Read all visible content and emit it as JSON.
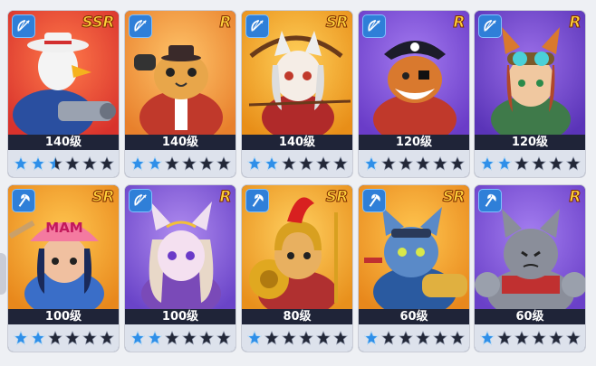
{
  "heroes": [
    {
      "rarity": "SSR",
      "level": "140级",
      "class_icon": "bow-icon",
      "stars_filled": 2.5,
      "art": "eagle-gunner",
      "colors": {
        "bg": "#d8322c",
        "bg2": "#ff7a4a"
      }
    },
    {
      "rarity": "R",
      "level": "140级",
      "class_icon": "bow-icon",
      "stars_filled": 2,
      "art": "fat-cat-banker",
      "colors": {
        "bg": "#e8802c",
        "bg2": "#ffc46a"
      }
    },
    {
      "rarity": "SR",
      "level": "140级",
      "class_icon": "bow-icon",
      "stars_filled": 2,
      "art": "white-cat-archer",
      "colors": {
        "bg": "#e88e18",
        "bg2": "#ffd05a"
      }
    },
    {
      "rarity": "R",
      "level": "120级",
      "class_icon": "bow-icon",
      "stars_filled": 1,
      "art": "pirate-cat",
      "colors": {
        "bg": "#6a3cc8",
        "bg2": "#a47bf0"
      }
    },
    {
      "rarity": "R",
      "level": "120级",
      "class_icon": "bow-icon",
      "stars_filled": 2,
      "art": "goggle-cat",
      "colors": {
        "bg": "#5a34b8",
        "bg2": "#9a6ee8"
      }
    },
    {
      "rarity": "SR",
      "level": "100级",
      "class_icon": "axe-icon",
      "stars_filled": 2,
      "art": "mama-cap-cat",
      "colors": {
        "bg": "#e8881c",
        "bg2": "#ffc650"
      }
    },
    {
      "rarity": "R",
      "level": "100级",
      "class_icon": "bow-icon",
      "stars_filled": 2,
      "art": "lilac-elf-cat",
      "colors": {
        "bg": "#6a44c8",
        "bg2": "#b08cf0"
      }
    },
    {
      "rarity": "SR",
      "level": "80级",
      "class_icon": "axe-icon",
      "stars_filled": 1,
      "art": "spartan-cat",
      "colors": {
        "bg": "#e8901c",
        "bg2": "#ffd060"
      }
    },
    {
      "rarity": "SR",
      "level": "60级",
      "class_icon": "axe-icon",
      "stars_filled": 1,
      "art": "blue-armored-cat",
      "colors": {
        "bg": "#e8881c",
        "bg2": "#ffc650"
      }
    },
    {
      "rarity": "R",
      "level": "60级",
      "class_icon": "axe-icon",
      "stars_filled": 1,
      "art": "grey-knight-cat",
      "colors": {
        "bg": "#6a40c8",
        "bg2": "#a47ef0"
      }
    }
  ],
  "stars_total": 6,
  "theme": {
    "rarity_text": "#ffd23a",
    "class_badge": "#2f7fd8",
    "star_filled": "#2f8fe8",
    "star_empty": "#232838"
  }
}
